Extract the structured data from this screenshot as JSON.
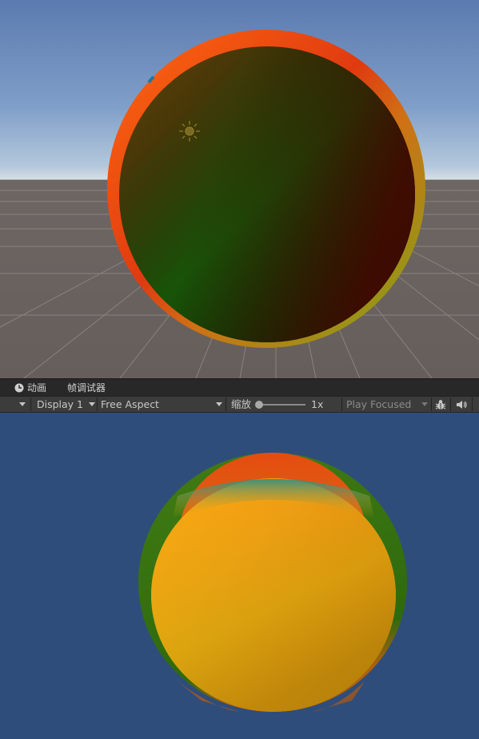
{
  "tabs": {
    "animation_label": "动画",
    "frame_debugger_label": "帧调试器"
  },
  "toolbar": {
    "display": "Display 1",
    "aspect": "Free Aspect",
    "scale_label": "缩放",
    "scale_value": "1x",
    "play_mode": "Play Focused"
  },
  "icons": {
    "tab_animation": "clock-icon",
    "sun_gizmo": "sun-icon",
    "stats": "bug-icon",
    "audio": "speaker-icon"
  },
  "colors": {
    "sky_top": "#5b7bb0",
    "horizon": "#d6dee4",
    "ground": "#665e5b",
    "game_background": "#2f4d7a",
    "toolbar_background": "#3c3c3c",
    "tab_background": "#282828"
  }
}
